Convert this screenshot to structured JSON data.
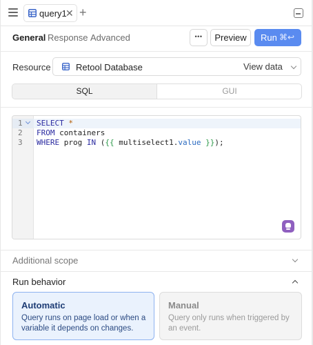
{
  "tab": {
    "label": "query1",
    "close_glyph": "✕",
    "add_glyph": "+"
  },
  "subtabs": {
    "general": "General",
    "response": "Response",
    "advanced": "Advanced"
  },
  "toolbar": {
    "more_label": "•••",
    "preview_label": "Preview",
    "run_label": "Run",
    "run_shortcut": "⌘↩"
  },
  "resource": {
    "label": "Resource",
    "value": "Retool Database",
    "view_data": "View data"
  },
  "mode_toggle": {
    "sql": "SQL",
    "gui": "GUI",
    "selected": "SQL"
  },
  "editor": {
    "lines": [
      "1",
      "2",
      "3"
    ],
    "line1": {
      "kw": "SELECT",
      "star": "*"
    },
    "line2": {
      "kw": "FROM",
      "rest": "containers"
    },
    "line3": {
      "kw1": "WHERE",
      "ident": "prog",
      "kw2": "IN",
      "open": "(",
      "tpl_open": "{{",
      "obj": "multiselect1",
      "dot": ".",
      "prop": "value",
      "tpl_close": "}}",
      "close": ");"
    }
  },
  "sections": {
    "additional_scope": "Additional scope",
    "run_behavior": "Run behavior"
  },
  "run_behavior": {
    "automatic": {
      "title": "Automatic",
      "description": "Query runs on page load or when a variable it depends on changes.",
      "selected": true
    },
    "manual": {
      "title": "Manual",
      "description": "Query only runs when triggered by an event.",
      "selected": false
    }
  },
  "colors": {
    "run_button": "#5a8bf0",
    "selected_card_bg": "#eaf2fd",
    "selected_card_border": "#8db2f0",
    "assistant": "#8f5fbf"
  },
  "icons": [
    "menu-icon",
    "table-icon",
    "close-icon",
    "plus-icon",
    "collapse-panel-icon",
    "ellipsis-icon",
    "enter-key-icon",
    "database-icon",
    "chevron-down-icon",
    "chevron-up-icon",
    "fold-icon",
    "assistant-icon"
  ]
}
